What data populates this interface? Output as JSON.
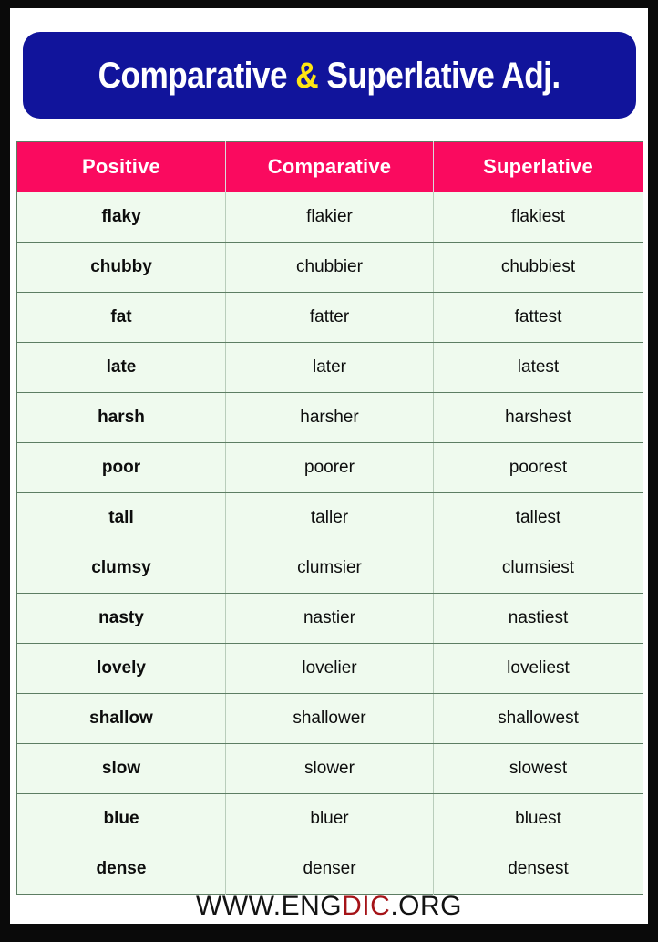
{
  "banner": {
    "title_part1": "Comparative ",
    "title_amp": "&",
    "title_part2": " Superlative Adj."
  },
  "table": {
    "columns": [
      "Positive",
      "Comparative",
      "Superlative"
    ],
    "rows": [
      [
        "flaky",
        "flakier",
        "flakiest"
      ],
      [
        "chubby",
        "chubbier",
        "chubbiest"
      ],
      [
        "fat",
        "fatter",
        "fattest"
      ],
      [
        "late",
        "later",
        "latest"
      ],
      [
        "harsh",
        "harsher",
        "harshest"
      ],
      [
        "poor",
        "poorer",
        "poorest"
      ],
      [
        "tall",
        "taller",
        "tallest"
      ],
      [
        "clumsy",
        "clumsier",
        "clumsiest"
      ],
      [
        "nasty",
        "nastier",
        "nastiest"
      ],
      [
        "lovely",
        "lovelier",
        "loveliest"
      ],
      [
        "shallow",
        "shallower",
        "shallowest"
      ],
      [
        "slow",
        "slower",
        "slowest"
      ],
      [
        "blue",
        "bluer",
        "bluest"
      ],
      [
        "dense",
        "denser",
        "densest"
      ]
    ]
  },
  "footer": {
    "prefix": "WWW.ENG",
    "highlight": "DIC",
    "suffix": ".ORG"
  },
  "colors": {
    "banner_blue": "#11149b",
    "amp_yellow": "#ffe612",
    "header_pink": "#fa0a5f",
    "row_mint": "#effaee",
    "frame_black": "#0a0a0a",
    "footer_red": "#a51318"
  }
}
